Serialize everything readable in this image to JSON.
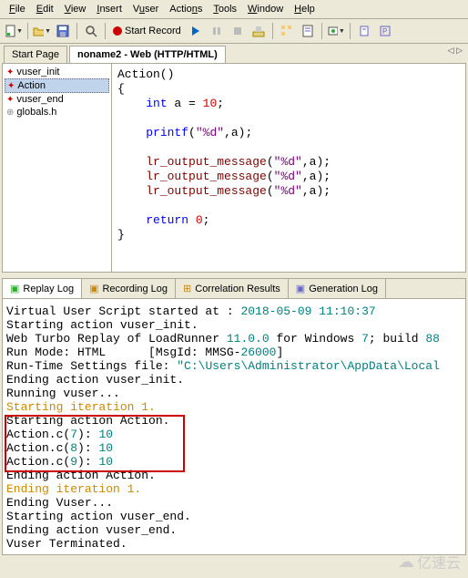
{
  "menu": [
    "File",
    "Edit",
    "View",
    "Insert",
    "Vuser",
    "Actions",
    "Tools",
    "Window",
    "Help"
  ],
  "toolbar": {
    "start_record": "Start Record"
  },
  "tabs": {
    "start": "Start Page",
    "active": "noname2 - Web (HTTP/HTML)"
  },
  "sidebar": {
    "items": [
      "vuser_init",
      "Action",
      "vuser_end",
      "globals.h"
    ]
  },
  "code": {
    "l1": "Action()",
    "l2": "{",
    "l3a": "    ",
    "l3b": "int",
    "l3c": " a = ",
    "l3d": "10",
    "l3e": ";",
    "l4a": "    ",
    "l4b": "printf",
    "l4c": "(",
    "l4d": "\"%d\"",
    "l4e": ",a);",
    "l5a": "    ",
    "l5b": "lr_output_message",
    "l5c": "(",
    "l5d": "\"%d\"",
    "l5e": ",a);",
    "l6a": "    ",
    "l6b": "lr_output_message",
    "l6c": "(",
    "l6d": "\"%d\"",
    "l6e": ",a);",
    "l7a": "    ",
    "l7b": "lr_output_message",
    "l7c": "(",
    "l7d": "\"%d\"",
    "l7e": ",a);",
    "l8a": "    ",
    "l8b": "return",
    "l8c": " ",
    "l8d": "0",
    "l8e": ";",
    "l9": "}"
  },
  "out_tabs": [
    "Replay Log",
    "Recording Log",
    "Correlation Results",
    "Generation Log"
  ],
  "output": {
    "l1a": "Virtual User Script started at : ",
    "l1b": "2018-05-09 11:10:37",
    "l2": "Starting action vuser_init.",
    "l3a": "Web Turbo Replay of LoadRunner ",
    "l3b": "11.0.0",
    "l3c": " for Windows ",
    "l3d": "7",
    "l3e": "; build ",
    "l3f": "88",
    "l4a": "Run Mode: HTML      [MsgId: MMSG-",
    "l4b": "26000",
    "l4c": "]",
    "l5a": "Run-Time Settings file: ",
    "l5b": "\"C:\\Users\\Administrator\\AppData\\Local",
    "l6": "Ending action vuser_init.",
    "l7": "Running vuser...",
    "l8": "Starting iteration 1.",
    "l9": "Starting action Action.",
    "l10a": "Action.c(",
    "l10b": "7",
    "l10c": "): ",
    "l10d": "10",
    "l11a": "Action.c(",
    "l11b": "8",
    "l11c": "): ",
    "l11d": "10",
    "l12a": "Action.c(",
    "l12b": "9",
    "l12c": "): ",
    "l12d": "10",
    "l13": "Ending action Action.",
    "l14": "Ending iteration 1.",
    "l15": "Ending Vuser...",
    "l16": "Starting action vuser_end.",
    "l17": "Ending action vuser_end.",
    "l18": "Vuser Terminated."
  },
  "watermark": "亿速云"
}
